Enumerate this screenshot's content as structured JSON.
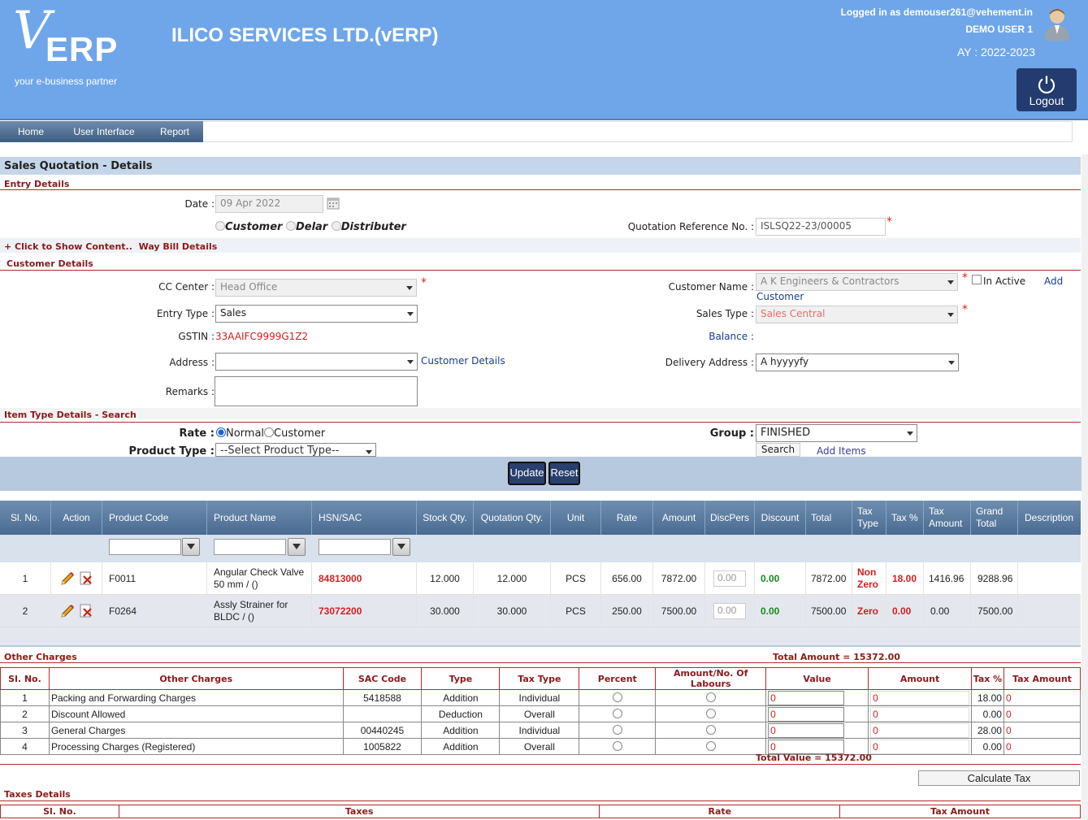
{
  "header": {
    "logo_letter": "V",
    "logo_text": "ERP",
    "tagline": "your e-business partner",
    "company": "ILICO SERVICES LTD.(vERP)",
    "logged_in": "Logged in as demouser261@vehement.in",
    "user": "DEMO USER 1",
    "ay": "AY : 2022-2023",
    "logout": "Logout"
  },
  "nav": {
    "items": [
      "Home",
      "User Interface",
      "Report"
    ]
  },
  "page_title": "Sales Quotation - Details",
  "entry": {
    "section": "Entry Details",
    "date_label": "Date",
    "date_value": "09 Apr 2022",
    "party_types": [
      "Customer",
      "Delar",
      "Distributer"
    ],
    "quote_ref_label": "Quotation Reference No.",
    "quote_ref_value": "ISLSQ22-23/00005",
    "waybill_toggle": "+ Click to Show Content..",
    "waybill_label": "Way Bill Details"
  },
  "customer": {
    "section": "Customer Details",
    "cc_label": "CC Center",
    "cc_value": "Head Office",
    "entry_type_label": "Entry Type",
    "entry_type_value": "Sales",
    "gstin_label": "GSTIN",
    "gstin_value": "33AAIFC9999G1Z2",
    "address_label": "Address",
    "address_value": "",
    "customer_details_link": "Customer Details",
    "remarks_label": "Remarks",
    "remarks_value": "",
    "customer_name_label": "Customer Name",
    "customer_name_value": "A K Engineers & Contractors",
    "inactive_label": "In Active",
    "add_customer_1": "Add",
    "add_customer_2": "Customer",
    "sales_type_label": "Sales Type",
    "sales_type_value": "Sales Central",
    "balance_label": "Balance",
    "delivery_label": "Delivery Address",
    "delivery_value": "A hyyyyfy"
  },
  "item_search": {
    "section": "Item Type Details - Search",
    "rate_label": "Rate",
    "rate_options": [
      "Normal",
      "Customer"
    ],
    "product_type_label": "Product Type",
    "product_type_value": "--Select Product Type--",
    "group_label": "Group",
    "group_value": "FINISHED",
    "search": "Search",
    "add_items": "Add Items"
  },
  "actions": {
    "update": "Update",
    "reset": "Reset"
  },
  "grid": {
    "columns": [
      "Sl. No.",
      "Action",
      "Product Code",
      "Product Name",
      "HSN/SAC",
      "Stock Qty.",
      "Quotation Qty.",
      "Unit",
      "Rate",
      "Amount",
      "DiscPers",
      "Discount",
      "Total",
      "Tax Type",
      "Tax %",
      "Tax Amount",
      "Grand Total",
      "Description"
    ],
    "rows": [
      {
        "sl": "1",
        "code": "F0011",
        "name": "Angular Check Valve 50 mm / ()",
        "hsn": "84813000",
        "stock": "12.000",
        "qty": "12.000",
        "unit": "PCS",
        "rate": "656.00",
        "amount": "7872.00",
        "discpers": "0.00",
        "discount": "0.00",
        "total": "7872.00",
        "tax_type": "Non Zero",
        "tax_pct": "18.00",
        "tax_amt": "1416.96",
        "grand": "9288.96",
        "desc": ""
      },
      {
        "sl": "2",
        "code": "F0264",
        "name": "Assly Strainer for BLDC / ()",
        "hsn": "73072200",
        "stock": "30.000",
        "qty": "30.000",
        "unit": "PCS",
        "rate": "250.00",
        "amount": "7500.00",
        "discpers": "0.00",
        "discount": "0.00",
        "total": "7500.00",
        "tax_type": "Zero",
        "tax_pct": "0.00",
        "tax_amt": "0.00",
        "grand": "7500.00",
        "desc": ""
      }
    ]
  },
  "other_charges": {
    "section": "Other Charges",
    "total_amount": "Total Amount  = 15372.00",
    "columns": [
      "Sl. No.",
      "Other Charges",
      "SAC Code",
      "Type",
      "Tax Type",
      "Percent",
      "Amount/No. Of Labours",
      "Value",
      "Amount",
      "Tax %",
      "Tax Amount"
    ],
    "rows": [
      {
        "sl": "1",
        "name": "Packing and Forwarding Charges",
        "sac": "5418588",
        "type": "Addition",
        "tax_type": "Individual",
        "value": "0",
        "amount": "0",
        "tax_pct": "18.00",
        "tax_amt": "0"
      },
      {
        "sl": "2",
        "name": "Discount Allowed",
        "sac": "",
        "type": "Deduction",
        "tax_type": "Overall",
        "value": "0",
        "amount": "0",
        "tax_pct": "0.00",
        "tax_amt": "0"
      },
      {
        "sl": "3",
        "name": "General Charges",
        "sac": "00440245",
        "type": "Addition",
        "tax_type": "Individual",
        "value": "0",
        "amount": "0",
        "tax_pct": "28.00",
        "tax_amt": "0"
      },
      {
        "sl": "4",
        "name": "Processing Charges (Registered)",
        "sac": "1005822",
        "type": "Addition",
        "tax_type": "Overall",
        "value": "0",
        "amount": "0",
        "tax_pct": "0.00",
        "tax_amt": "0"
      }
    ],
    "total_value": "Total Value = 15372.00",
    "calculate_tax": "Calculate Tax"
  },
  "taxes": {
    "section": "Taxes Details",
    "columns": [
      "Sl. No.",
      "Taxes",
      "Rate",
      "Tax Amount"
    ]
  },
  "colors": {
    "header": "#6fa6ea",
    "nav": "#4a6b91",
    "section_text": "#8b1a1a",
    "accent_red": "#d42020",
    "link": "#1a3c9a",
    "green": "#1a8a1a"
  }
}
